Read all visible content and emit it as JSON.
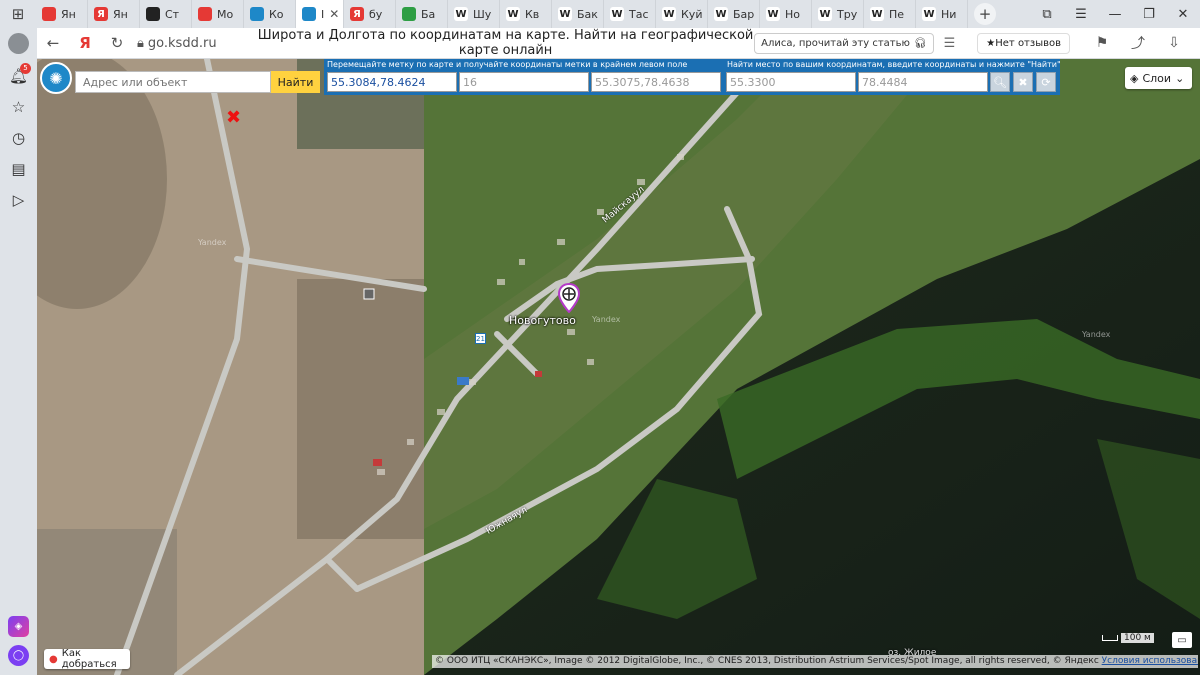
{
  "tabs": [
    {
      "label": "Ян",
      "color": "#e53935",
      "icon": "bookmark-icon"
    },
    {
      "label": "Ян",
      "color": "#e53935",
      "icon": "yandex-icon"
    },
    {
      "label": "Ст",
      "color": "#222222",
      "icon": "plus-square-icon"
    },
    {
      "label": "Мо",
      "color": "#e53935",
      "icon": "mail-icon"
    },
    {
      "label": "Ко",
      "color": "#1e88c8",
      "icon": "globe-icon"
    },
    {
      "label": "I",
      "color": "#1e88c8",
      "icon": "globe-icon",
      "active": true
    },
    {
      "label": "бу",
      "color": "#e53935",
      "icon": "yandex-icon"
    },
    {
      "label": "Ба",
      "color": "#2e9e44",
      "icon": "puzzle-icon"
    },
    {
      "label": "Шу",
      "color": "#333333",
      "icon": "wikipedia-icon"
    },
    {
      "label": "Кв",
      "color": "#333333",
      "icon": "wikipedia-icon"
    },
    {
      "label": "Бак",
      "color": "#333333",
      "icon": "wikipedia-icon"
    },
    {
      "label": "Тас",
      "color": "#333333",
      "icon": "wikipedia-icon"
    },
    {
      "label": "Куй",
      "color": "#333333",
      "icon": "wikipedia-icon"
    },
    {
      "label": "Бар",
      "color": "#333333",
      "icon": "wikipedia-icon"
    },
    {
      "label": "Но",
      "color": "#333333",
      "icon": "wikipedia-icon"
    },
    {
      "label": "Тру",
      "color": "#333333",
      "icon": "wikipedia-icon"
    },
    {
      "label": "Пе",
      "color": "#333333",
      "icon": "wikipedia-icon"
    },
    {
      "label": "Ни",
      "color": "#333333",
      "icon": "wikipedia-icon"
    }
  ],
  "sidebar": {
    "notification_count": "5"
  },
  "address": {
    "url": "go.ksdd.ru",
    "title": "Широта и Долгота по координатам на карте. Найти на географической карте онлайн",
    "alisa": "Алиса, прочитай эту статью",
    "reviews": "★Нет отзывов"
  },
  "map": {
    "search_placeholder": "Адрес или объект",
    "search_button": "Найти",
    "panel1_caption": "Перемещайте метку по карте и получайте координаты метки в крайнем левом поле",
    "panel1_coord": "55.3084,78.4624",
    "panel1_zoom": "16",
    "panel1_corner": "55.3075,78.4638",
    "panel2_caption": "Найти место по вашим координатам, введите координаты и нажмите \"Найти\"",
    "panel2_lat": "55.3300",
    "panel2_lon": "78.4484",
    "layers": "Слои",
    "route": "Как добраться",
    "town": "Новогутово",
    "road1": "Майскауул",
    "road2": "Южнаяул",
    "lake": "оз. Жилое",
    "scale": "100 м",
    "copyright": "© ООО ИТЦ «СКАНЭКС», Image © 2012 DigitalGlobe, Inc., © CNES 2013, Distribution Astrium Services/Spot Image, all rights reserved, © Яндекс ",
    "tos": "Условия использования",
    "watermark": "Yandex"
  }
}
